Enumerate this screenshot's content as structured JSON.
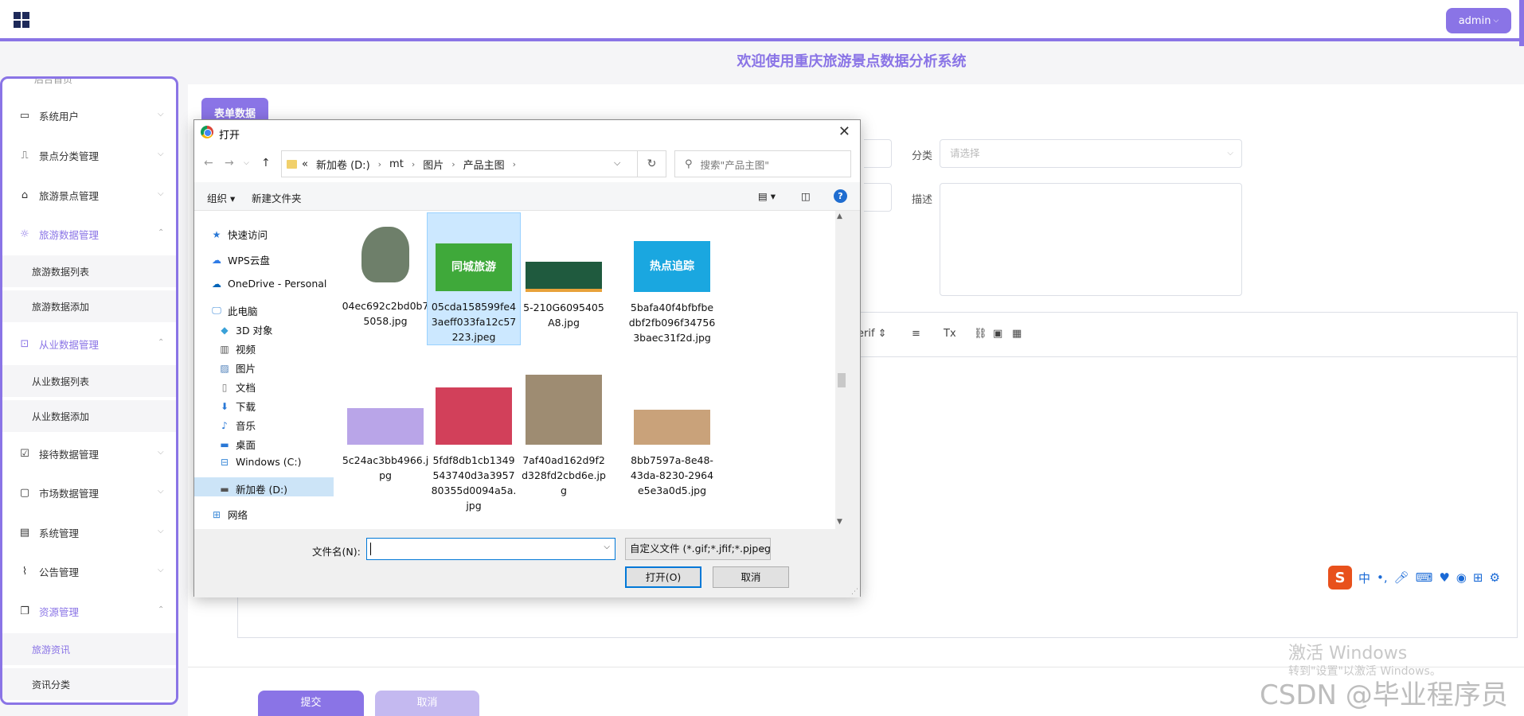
{
  "topbar": {
    "admin_label": "admin"
  },
  "welcome": "欢迎使用重庆旅游景点数据分析系统",
  "sidebar": {
    "top_partial": "后台首页",
    "items": [
      {
        "label": "系统用户",
        "icon": "laptop-icon",
        "expanded": false
      },
      {
        "label": "景点分类管理",
        "icon": "bookmark-icon",
        "expanded": false
      },
      {
        "label": "旅游景点管理",
        "icon": "tag-icon",
        "expanded": false
      },
      {
        "label": "旅游数据管理",
        "icon": "sun-icon",
        "expanded": true
      },
      {
        "label": "旅游数据列表"
      },
      {
        "label": "旅游数据添加"
      },
      {
        "label": "从业数据管理",
        "icon": "inbox-icon",
        "expanded": true
      },
      {
        "label": "从业数据列表"
      },
      {
        "label": "从业数据添加"
      },
      {
        "label": "接待数据管理",
        "icon": "clipboard-icon",
        "expanded": false
      },
      {
        "label": "市场数据管理",
        "icon": "chat-icon",
        "expanded": false
      },
      {
        "label": "系统管理",
        "icon": "archive-icon",
        "expanded": false
      },
      {
        "label": "公告管理",
        "icon": "paperclip-icon",
        "expanded": false
      },
      {
        "label": "资源管理",
        "icon": "copy-icon",
        "expanded": true
      },
      {
        "label": "旅游资讯"
      },
      {
        "label": "资讯分类"
      }
    ]
  },
  "form": {
    "tab_label": "表单数据",
    "category_label": "分类",
    "category_placeholder": "请选择",
    "desc_label": "描述",
    "editor_font_partial": "erif",
    "submit_label": "提交",
    "cancel_label": "取消"
  },
  "dialog": {
    "title": "打开",
    "path": [
      "«",
      "新加卷 (D:)",
      "mt",
      "图片",
      "产品主图"
    ],
    "search_placeholder": "搜索\"产品主图\"",
    "organize": "组织 ▾",
    "new_folder": "新建文件夹",
    "tree": [
      "快速访问",
      "WPS云盘",
      "OneDrive - Personal",
      "此电脑",
      "3D 对象",
      "视频",
      "图片",
      "文档",
      "下载",
      "音乐",
      "桌面",
      "Windows (C:)",
      "新加卷 (D:)",
      "网络"
    ],
    "files": [
      {
        "name": "04ec692c2bd0b75058.jpg",
        "thumb_color": "#6e7f6a",
        "thumb_text": ""
      },
      {
        "name": "05cda158599fe43aeff033fa12c57223.jpeg",
        "thumb_color": "#3fa93a",
        "thumb_text": "同城旅游"
      },
      {
        "name": "5-210G6095405A8.jpg",
        "thumb_color": "#1f5a3e",
        "thumb_text": ""
      },
      {
        "name": "5bafa40f4bfbfbedbf2fb096f347563baec31f2d.jpg",
        "thumb_color": "#1aa7e0",
        "thumb_text": "热点追踪"
      },
      {
        "name": "5c24ac3bb4966.jpg",
        "thumb_color": "#b9a5e8",
        "thumb_text": ""
      },
      {
        "name": "5fdf8db1cb1349543740d3a395780355d0094a5a.jpg",
        "thumb_color": "#d2405a",
        "thumb_text": ""
      },
      {
        "name": "7af40ad162d9f2d328fd2cbd6e.jpg",
        "thumb_color": "#9e8c72",
        "thumb_text": ""
      },
      {
        "name": "8bb7597a-8e48-43da-8230-2964e5e3a0d5.jpg",
        "thumb_color": "#c9a27a",
        "thumb_text": ""
      }
    ],
    "filename_label": "文件名(N):",
    "filename_value": "",
    "filter": "自定义文件 (*.gif;*.jfif;*.pjpeg;*",
    "open_label": "打开(O)",
    "cancel_label": "取消"
  },
  "ime": {
    "logo": "S",
    "lang": "中"
  },
  "watermarks": {
    "windows": "激活 Windows",
    "windows_sub": "转到\"设置\"以激活 Windows。",
    "csdn": "CSDN @毕业程序员"
  },
  "colors": {
    "accent": "#8a74e6",
    "selection": "#cce8ff"
  }
}
